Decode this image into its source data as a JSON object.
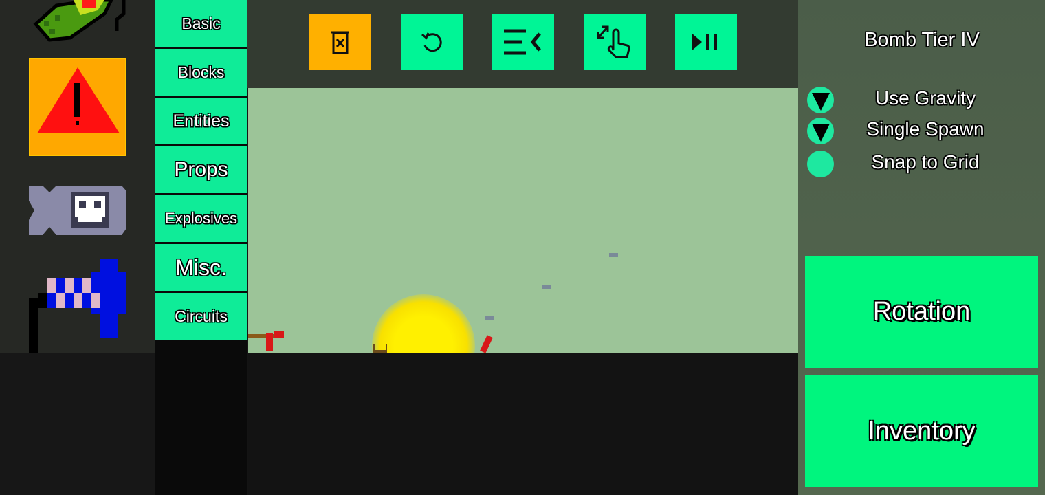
{
  "inventory_items": [
    {
      "name": "green-grenade-icon"
    },
    {
      "name": "warning-sign-icon",
      "selected": true
    },
    {
      "name": "skull-bomb-icon"
    },
    {
      "name": "blue-detonator-icon"
    },
    {
      "name": "green-missile-icon"
    }
  ],
  "categories": [
    {
      "label": "Basic"
    },
    {
      "label": "Blocks"
    },
    {
      "label": "Entities"
    },
    {
      "label": "Props"
    },
    {
      "label": "Explosives"
    },
    {
      "label": "Misc."
    },
    {
      "label": "Circuits"
    }
  ],
  "toolbar": [
    {
      "icon": "clear-trash-icon",
      "color": "#ffb000"
    },
    {
      "icon": "undo-icon",
      "color": "#00f596"
    },
    {
      "icon": "collapse-menu-icon",
      "color": "#00f596"
    },
    {
      "icon": "drag-gesture-icon",
      "color": "#00f596"
    },
    {
      "icon": "play-pause-icon",
      "color": "#00f596"
    }
  ],
  "panel": {
    "title": "Bomb Tier IV",
    "options": [
      {
        "label": "Use Gravity",
        "on": true
      },
      {
        "label": "Single Spawn",
        "on": true
      },
      {
        "label": "Snap to Grid",
        "on": false
      }
    ],
    "rotation_label": "Rotation",
    "inventory_label": "Inventory"
  },
  "colors": {
    "accent": "#00f596",
    "warning": "#ffb000",
    "sky": "#9cc498",
    "ground": "#131313"
  }
}
